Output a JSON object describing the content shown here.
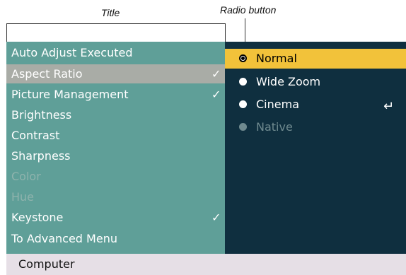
{
  "callouts": {
    "title": "Title",
    "radio_button": "Radio button"
  },
  "menu": {
    "items": [
      {
        "label": "Auto Adjust Executed",
        "state": "normal",
        "checked": false
      },
      {
        "label": "Aspect Ratio",
        "state": "selected",
        "checked": true
      },
      {
        "label": "Picture Management",
        "state": "normal",
        "checked": true
      },
      {
        "label": "Brightness",
        "state": "normal",
        "checked": false
      },
      {
        "label": "Contrast",
        "state": "normal",
        "checked": false
      },
      {
        "label": "Sharpness",
        "state": "normal",
        "checked": false
      },
      {
        "label": "Color",
        "state": "disabled",
        "checked": false
      },
      {
        "label": "Hue",
        "state": "disabled",
        "checked": false
      },
      {
        "label": "Keystone",
        "state": "normal",
        "checked": true
      },
      {
        "label": "To Advanced Menu",
        "state": "normal",
        "checked": false
      }
    ],
    "check_glyph": "✓"
  },
  "options": {
    "items": [
      {
        "label": "Normal",
        "state": "selected"
      },
      {
        "label": "Wide Zoom",
        "state": "normal"
      },
      {
        "label": "Cinema",
        "state": "normal"
      },
      {
        "label": "Native",
        "state": "disabled"
      }
    ],
    "enter_glyph": "↵"
  },
  "status_bar": {
    "label": "Computer"
  },
  "colors": {
    "menu_bg": "#5f9f98",
    "menu_selected": "#a9aca6",
    "panel_bg": "#0f2f3f",
    "option_selected": "#f2c23a",
    "status_bg": "#e6dfe6"
  }
}
